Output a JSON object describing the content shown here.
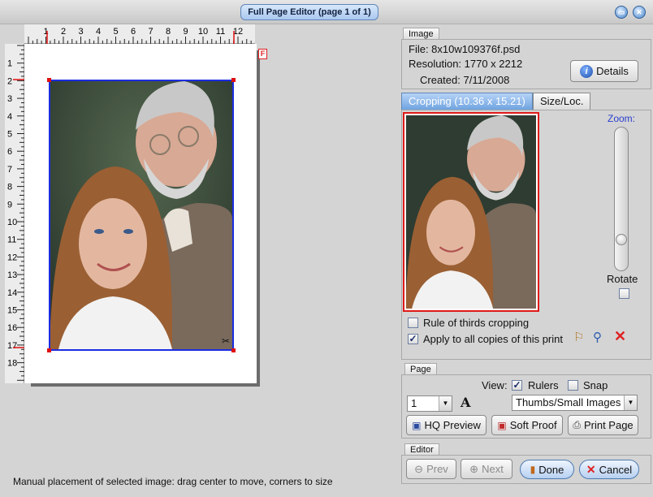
{
  "window": {
    "title": "Full Page Editor (page 1 of 1)"
  },
  "ruler": {
    "h_labels": [
      "1",
      "2",
      "3",
      "4",
      "5",
      "6",
      "7",
      "8",
      "9",
      "10",
      "11",
      "12"
    ],
    "v_labels": [
      "1",
      "2",
      "3",
      "4",
      "5",
      "6",
      "7",
      "8",
      "9",
      "10",
      "11",
      "12",
      "13",
      "14",
      "15",
      "16",
      "17",
      "18"
    ]
  },
  "status": {
    "text": "Manual placement of selected image: drag center to move, corners to size"
  },
  "image_group": {
    "label": "Image",
    "file": "File: 8x10w109376f.psd",
    "resolution": "Resolution: 1770 x 2212",
    "created": "Created: 7/11/2008",
    "details_label": "Details"
  },
  "tabs": [
    {
      "label": "Cropping (10.36 x 15.21)",
      "active": true
    },
    {
      "label": "Size/Loc.",
      "active": false
    }
  ],
  "cropping": {
    "zoom_label": "Zoom:",
    "zoom_level": 0.82,
    "rotate_label": "Rotate",
    "rule_of_thirds_label": "Rule of thirds cropping",
    "rule_of_thirds_checked": false,
    "apply_all_label": "Apply to all copies of this print",
    "apply_all_checked": true
  },
  "page_group": {
    "label": "Page",
    "view_label": "View:",
    "rulers_label": "Rulers",
    "rulers_checked": true,
    "snap_label": "Snap",
    "snap_checked": false,
    "copies_value": "1",
    "font_icon": "A",
    "view_mode_value": "Thumbs/Small Images",
    "hq_preview_label": "HQ Preview",
    "soft_proof_label": "Soft Proof",
    "print_page_label": "Print Page"
  },
  "editor_group": {
    "label": "Editor",
    "prev_label": "Prev",
    "next_label": "Next",
    "done_label": "Done",
    "cancel_label": "Cancel"
  },
  "colors": {
    "accent": "#2a3fd0",
    "crop_border": "#e01a1a",
    "selection_border": "#1c2de0"
  }
}
